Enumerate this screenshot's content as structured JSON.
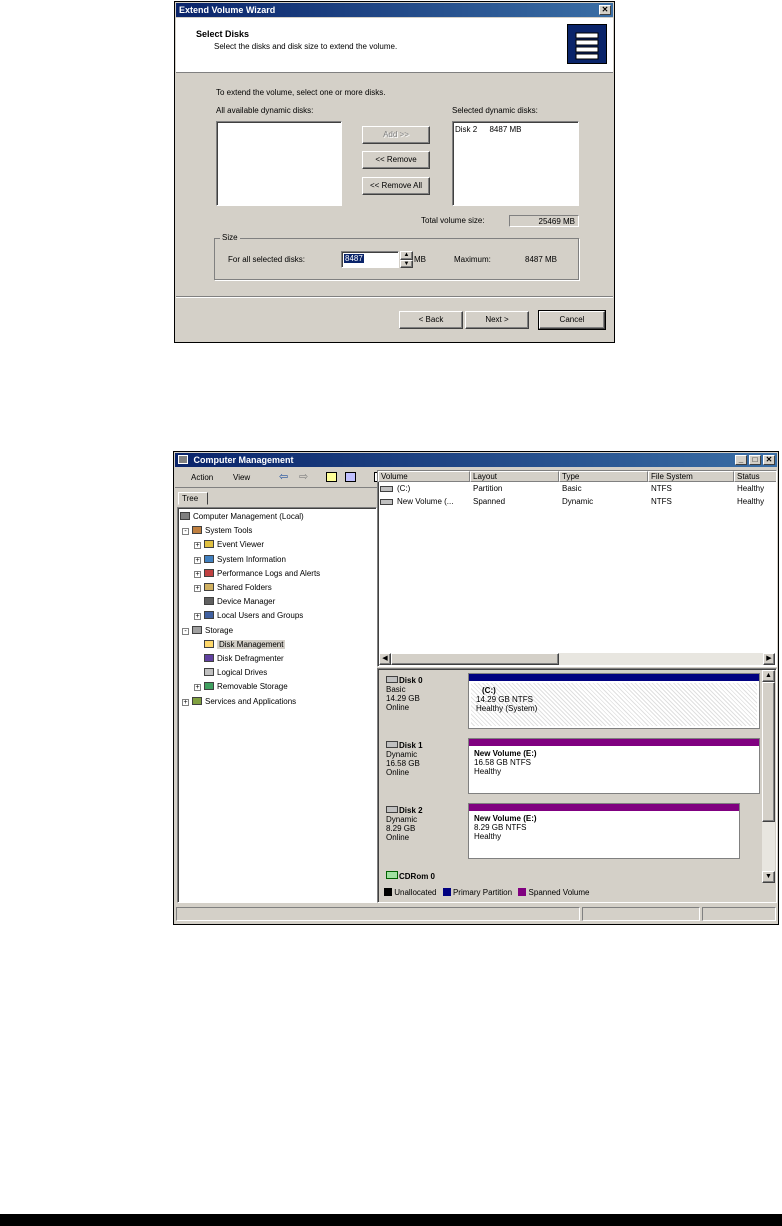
{
  "wizard": {
    "title": "Extend Volume Wizard",
    "heading": "Select Disks",
    "subheading": "Select the disks and disk size to extend the volume.",
    "instruction": "To extend the volume, select one or more disks.",
    "available_label": "All available dynamic disks:",
    "selected_label": "Selected dynamic disks:",
    "selected_items": [
      {
        "disk": "Disk 2",
        "size": "8487 MB"
      }
    ],
    "add_label": "Add >>",
    "remove_label": "<< Remove",
    "remove_all_label": "<< Remove All",
    "total_label": "Total volume size:",
    "total_value": "25469 MB",
    "size_group": "Size",
    "for_all_label": "For all selected disks:",
    "size_value": "8487",
    "size_unit": "MB",
    "maximum_label": "Maximum:",
    "maximum_value": "8487 MB",
    "back_label": "< Back",
    "next_label": "Next >",
    "cancel_label": "Cancel"
  },
  "cm": {
    "title": "Computer Management",
    "menu": [
      "Action",
      "View"
    ],
    "tree_tab": "Tree",
    "tree": [
      {
        "label": "Computer Management (Local)",
        "level": 0,
        "expander": ""
      },
      {
        "label": "System Tools",
        "level": 1,
        "expander": "-"
      },
      {
        "label": "Event Viewer",
        "level": 2,
        "expander": "+"
      },
      {
        "label": "System Information",
        "level": 2,
        "expander": "+"
      },
      {
        "label": "Performance Logs and Alerts",
        "level": 2,
        "expander": "+"
      },
      {
        "label": "Shared Folders",
        "level": 2,
        "expander": "+"
      },
      {
        "label": "Device Manager",
        "level": 2,
        "expander": ""
      },
      {
        "label": "Local Users and Groups",
        "level": 2,
        "expander": "+"
      },
      {
        "label": "Storage",
        "level": 1,
        "expander": "-"
      },
      {
        "label": "Disk Management",
        "level": 2,
        "expander": "",
        "selected": true
      },
      {
        "label": "Disk Defragmenter",
        "level": 2,
        "expander": ""
      },
      {
        "label": "Logical Drives",
        "level": 2,
        "expander": ""
      },
      {
        "label": "Removable Storage",
        "level": 2,
        "expander": "+"
      },
      {
        "label": "Services and Applications",
        "level": 1,
        "expander": "+"
      }
    ],
    "columns": [
      "Volume",
      "Layout",
      "Type",
      "File System",
      "Status"
    ],
    "rows": [
      [
        "(C:)",
        "Partition",
        "Basic",
        "NTFS",
        "Healthy"
      ],
      [
        "New Volume (...",
        "Spanned",
        "Dynamic",
        "NTFS",
        "Healthy"
      ]
    ],
    "disks": [
      {
        "name": "Disk 0",
        "type": "Basic",
        "size": "14.29 GB",
        "state": "Online",
        "vol_name": "(C:)",
        "vol_size": "14.29 GB NTFS",
        "vol_status": "Healthy (System)",
        "color": "#000080"
      },
      {
        "name": "Disk 1",
        "type": "Dynamic",
        "size": "16.58 GB",
        "state": "Online",
        "vol_name": "New Volume  (E:)",
        "vol_size": "16.58 GB NTFS",
        "vol_status": "Healthy",
        "color": "#800080"
      },
      {
        "name": "Disk 2",
        "type": "Dynamic",
        "size": "8.29 GB",
        "state": "Online",
        "vol_name": "New Volume  (E:)",
        "vol_size": "8.29 GB NTFS",
        "vol_status": "Healthy",
        "color": "#800080"
      },
      {
        "name": "CDRom 0"
      }
    ],
    "legend": [
      {
        "label": "Unallocated",
        "color": "#000000"
      },
      {
        "label": "Primary Partition",
        "color": "#000080"
      },
      {
        "label": "Spanned Volume",
        "color": "#800080"
      }
    ]
  }
}
